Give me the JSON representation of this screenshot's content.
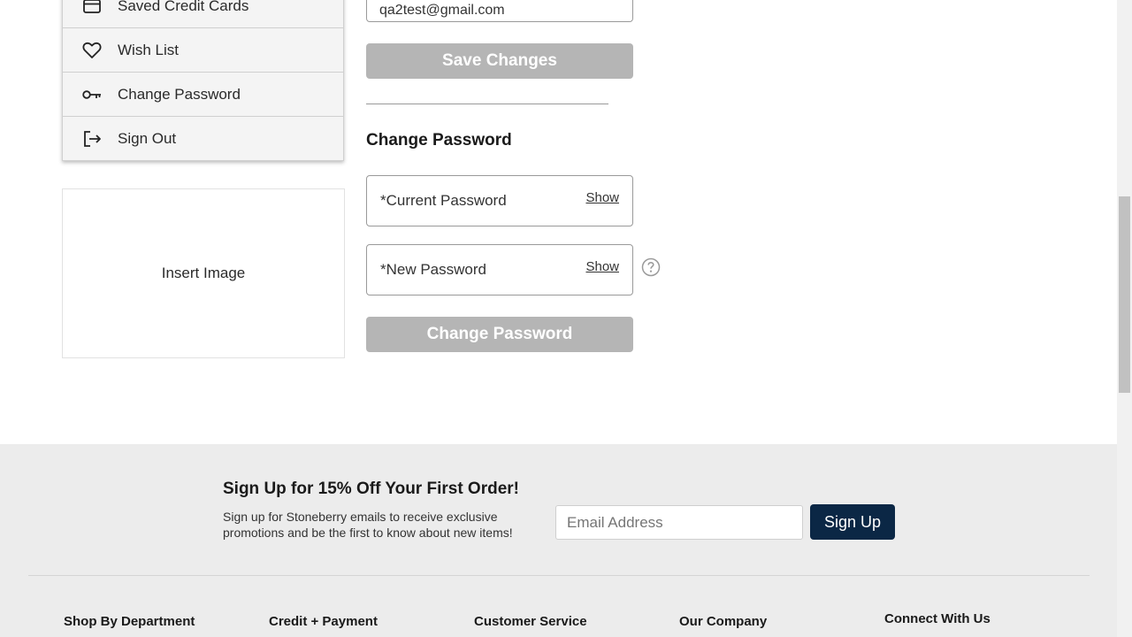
{
  "sidebar": {
    "items": [
      {
        "label": "Saved Credit Cards",
        "icon": "credit-card-icon"
      },
      {
        "label": "Wish List",
        "icon": "heart-icon"
      },
      {
        "label": "Change Password",
        "icon": "key-icon"
      },
      {
        "label": "Sign Out",
        "icon": "sign-out-icon"
      }
    ],
    "insert_image_label": "Insert Image"
  },
  "profile": {
    "email_value": "qa2test@gmail.com",
    "save_label": "Save Changes"
  },
  "change_password": {
    "title": "Change Password",
    "current_placeholder": "*Current Password",
    "new_placeholder": "*New Password",
    "show_label": "Show",
    "submit_label": "Change Password"
  },
  "footer": {
    "promo_title": "Sign Up for 15% Off Your First Order!",
    "promo_text": "Sign up for Stoneberry emails to receive exclusive promotions and be the first to know about new items!",
    "email_placeholder": "Email Address",
    "signup_label": "Sign Up",
    "columns": [
      "Shop By Department",
      "Credit + Payment",
      "Customer Service",
      "Our Company",
      "Connect With Us"
    ]
  },
  "colors": {
    "disabled_button": "#b5b5b5",
    "primary_navy": "#0b2745",
    "footer_bg": "#ececec"
  }
}
